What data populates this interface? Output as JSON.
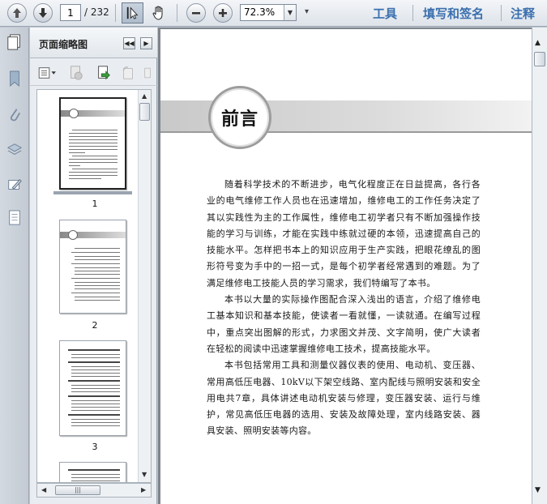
{
  "toolbar": {
    "current_page": "1",
    "total_pages": "/ 232",
    "zoom_value": "72.3%",
    "links": [
      "工具",
      "填写和签名",
      "注释"
    ]
  },
  "panel": {
    "title": "页面缩略图",
    "thumbnails": [
      {
        "number": "1"
      },
      {
        "number": "2"
      },
      {
        "number": "3"
      }
    ]
  },
  "document": {
    "title": "前言",
    "paragraphs": [
      "随着科学技术的不断进步，电气化程度正在日益提高，各行各业的电气维修工作人员也在迅速增加，维修电工的工作任务决定了其以实践性为主的工作属性，维修电工初学者只有不断加强操作技能的学习与训练，才能在实践中练就过硬的本领，迅速提高自己的技能水平。怎样把书本上的知识应用于生产实践，把眼花缭乱的图形符号变为手中的一招一式，是每个初学者经常遇到的难题。为了满足维修电工技能人员的学习需求，我们特编写了本书。",
      "本书以大量的实际操作图配合深入浅出的语言，介绍了维修电工基本知识和基本技能，使读者一看就懂，一读就通。在编写过程中，重点突出图解的形式，力求图文并茂、文字简明，使广大读者在轻松的阅读中迅速掌握维修电工技术，提高技能水平。",
      "本书包括常用工具和测量仪器仪表的使用、电动机、变压器、常用高低压电器、10kV以下架空线路、室内配线与照明安装和安全用电共7章，具体讲述电动机安装与修理，变压器安装、运行与维护，常见高低压电器的选用、安装及故障处理，室内线路安装、器具安装、照明安装等内容。"
    ]
  },
  "icons": {
    "toolbar": [
      "previous-page-icon",
      "next-page-icon",
      "select-tool-icon",
      "hand-tool-icon",
      "zoom-out-icon",
      "zoom-in-icon",
      "dropdown-icon"
    ],
    "rail": [
      "bookmark-icon",
      "attachment-icon",
      "layers-icon",
      "signature-icon",
      "page-icon"
    ],
    "panel": [
      "pages-icon",
      "options-icon",
      "delete-page-icon",
      "insert-page-icon",
      "rotate-icon",
      "print-icon"
    ]
  },
  "colors": {
    "link": "#3a6fae",
    "toolbar_bg": "#dde3ea",
    "header_band": "#c9c9c9"
  }
}
